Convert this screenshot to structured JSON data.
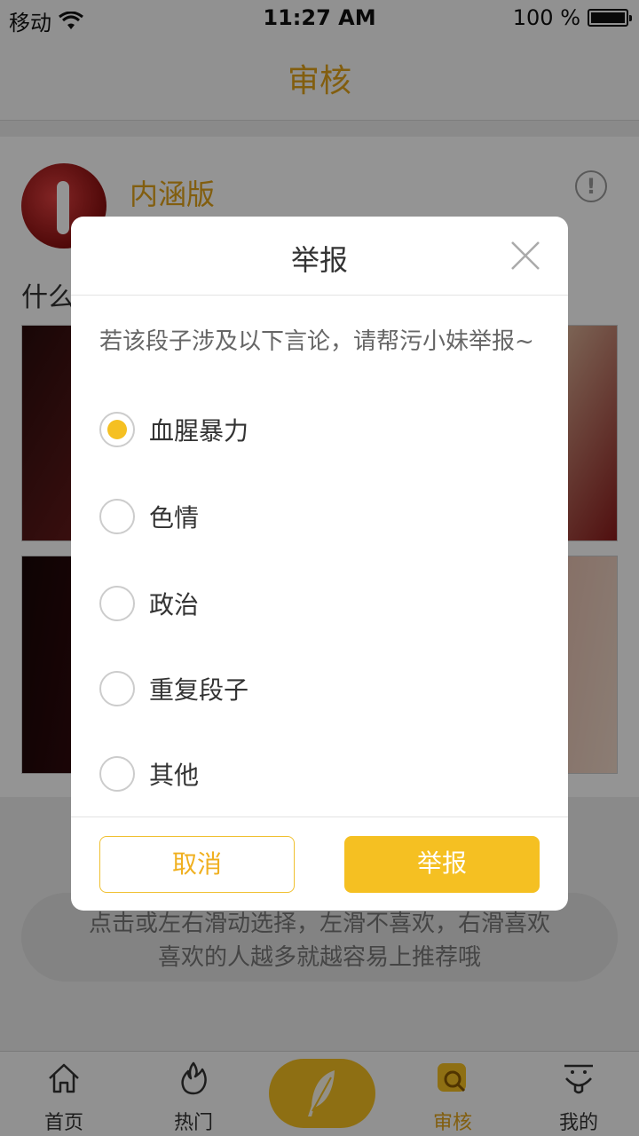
{
  "status_bar": {
    "carrier": "移动",
    "time": "11:27 AM",
    "battery": "100 %"
  },
  "header": {
    "title": "审核"
  },
  "post": {
    "author": "内涵版",
    "text": "什么"
  },
  "hint": {
    "line1": "点击或左右滑动选择，左滑不喜欢，右滑喜欢",
    "line2": "喜欢的人越多就越容易上推荐哦"
  },
  "tabbar": {
    "home": "首页",
    "hot": "热门",
    "review": "审核",
    "mine": "我的"
  },
  "dialog": {
    "title": "举报",
    "description": "若该段子涉及以下言论，请帮污小妹举报~",
    "options": [
      {
        "label": "血腥暴力",
        "selected": true
      },
      {
        "label": "色情",
        "selected": false
      },
      {
        "label": "政治",
        "selected": false
      },
      {
        "label": "重复段子",
        "selected": false
      },
      {
        "label": "其他",
        "selected": false
      }
    ],
    "cancel_label": "取消",
    "report_label": "举报"
  },
  "colors": {
    "accent": "#f5c022",
    "title_gold": "#e0a31a"
  }
}
